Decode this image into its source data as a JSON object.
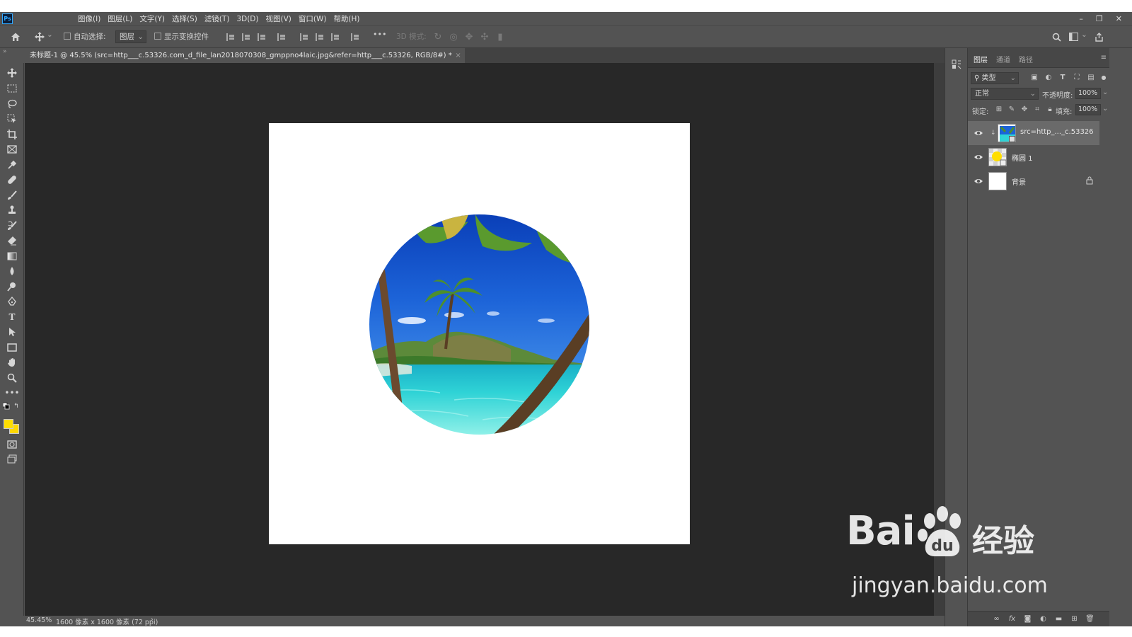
{
  "app": {
    "logo_text": "Ps",
    "menu": [
      "图像(I)",
      "图层(L)",
      "文字(Y)",
      "选择(S)",
      "滤镜(T)",
      "3D(D)",
      "视图(V)",
      "窗口(W)",
      "帮助(H)"
    ],
    "window_controls": {
      "minimize": "–",
      "restore": "❐",
      "close": "✕"
    }
  },
  "options_bar": {
    "auto_select_label": "自动选择:",
    "auto_select_target": "图层",
    "show_transform_label": "显示变换控件",
    "more": "•••",
    "mode_3d_label": "3D 模式:"
  },
  "document": {
    "tab_title": "未标题-1 @ 45.5% (src=http___c.53326.com_d_file_lan2018070308_gmppno4laic.jpg&refer=http___c.53326, RGB/8#) *",
    "tab_close": "×"
  },
  "colors": {
    "foreground": "#ffde00",
    "background": "#ffd800",
    "ps_blue": "#31a8ff",
    "canvas_bg": "#282828",
    "ui_gray": "#535353"
  },
  "layers_panel": {
    "tabs": [
      "图层",
      "通道",
      "路径"
    ],
    "active_tab": 0,
    "filter_label": "类型",
    "blend_mode": "正常",
    "opacity_label": "不透明度:",
    "opacity_value": "100%",
    "lock_label": "锁定:",
    "fill_label": "填充:",
    "fill_value": "100%",
    "layers": [
      {
        "name": "src=http_..._c.53326",
        "visible": true,
        "selected": true,
        "locked": false
      },
      {
        "name": "椭圆 1",
        "visible": true,
        "selected": false,
        "locked": false
      },
      {
        "name": "背景",
        "visible": true,
        "selected": false,
        "locked": true
      }
    ]
  },
  "status_bar": {
    "zoom": "45.45%",
    "doc_info": "1600 像素 x 1600 像素 (72 ppi)",
    "arrow": "›"
  },
  "watermark": {
    "brand": "Bai",
    "brand_cn": "经验",
    "url": "jingyan.baidu.com"
  },
  "icons": {
    "home": "home-icon",
    "move": "move-icon",
    "search": "search-icon",
    "workspace": "workspace-icon",
    "share": "share-icon",
    "eye": "eye-icon",
    "lock": "lock-icon"
  }
}
